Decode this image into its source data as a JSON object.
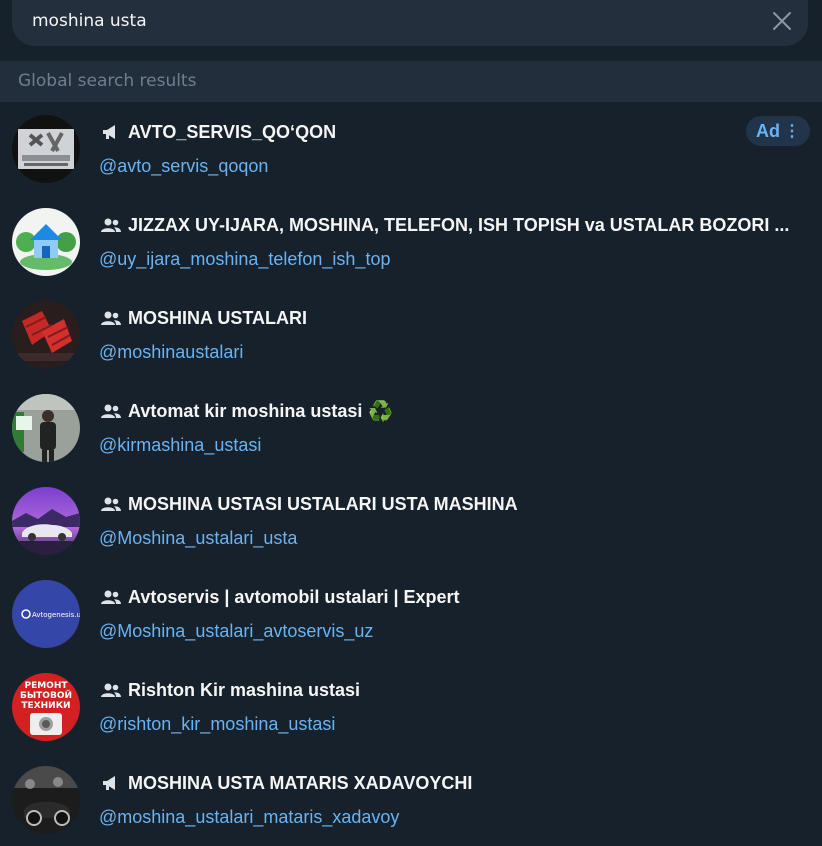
{
  "search": {
    "query": "moshina usta",
    "clear_icon": "close-icon"
  },
  "section": {
    "title": "Global search results"
  },
  "ad": {
    "label": "Ad",
    "dots": "⋮"
  },
  "results": [
    {
      "kind": "channel",
      "title": "AVTO_SERVIS_QO‘QON",
      "username": "@avto_servis_qoqon"
    },
    {
      "kind": "group",
      "title": "JIZZAX UY-IJARA, MOSHINA, TELEFON, ISH TOPISH va USTALAR BOZORI ...",
      "username": "@uy_ijara_moshina_telefon_ish_top"
    },
    {
      "kind": "group",
      "title": "MOSHINA USTALARI",
      "username": "@moshinaustalari"
    },
    {
      "kind": "group",
      "title": "Avtomat kir moshina ustasi",
      "emoji": "♻️",
      "username": "@kirmashina_ustasi"
    },
    {
      "kind": "group",
      "title": "MOSHINA USTASI USTALARI USTA MASHINA",
      "username": "@Moshina_ustalari_usta"
    },
    {
      "kind": "group",
      "title": "Avtoservis | avtomobil ustalari | Expert",
      "username": "@Moshina_ustalari_avtoservis_uz"
    },
    {
      "kind": "group",
      "title": "Rishton Kir mashina ustasi",
      "username": "@rishton_kir_moshina_ustasi"
    },
    {
      "kind": "channel",
      "title": "MOSHINA USTA MATARIS XADAVOYCHI",
      "username": "@moshina_ustalari_mataris_xadavoy"
    }
  ],
  "avatar_text": {
    "avtogenesis": "Avtogenesis.uz",
    "remont_lines": [
      "РЕМОНТ",
      "БЫТОВОЙ",
      "ТЕХНИКИ"
    ]
  },
  "colors": {
    "background": "#17212b",
    "accent": "#6ab3f3",
    "header": "#232e3c",
    "search": "#242f3d"
  }
}
